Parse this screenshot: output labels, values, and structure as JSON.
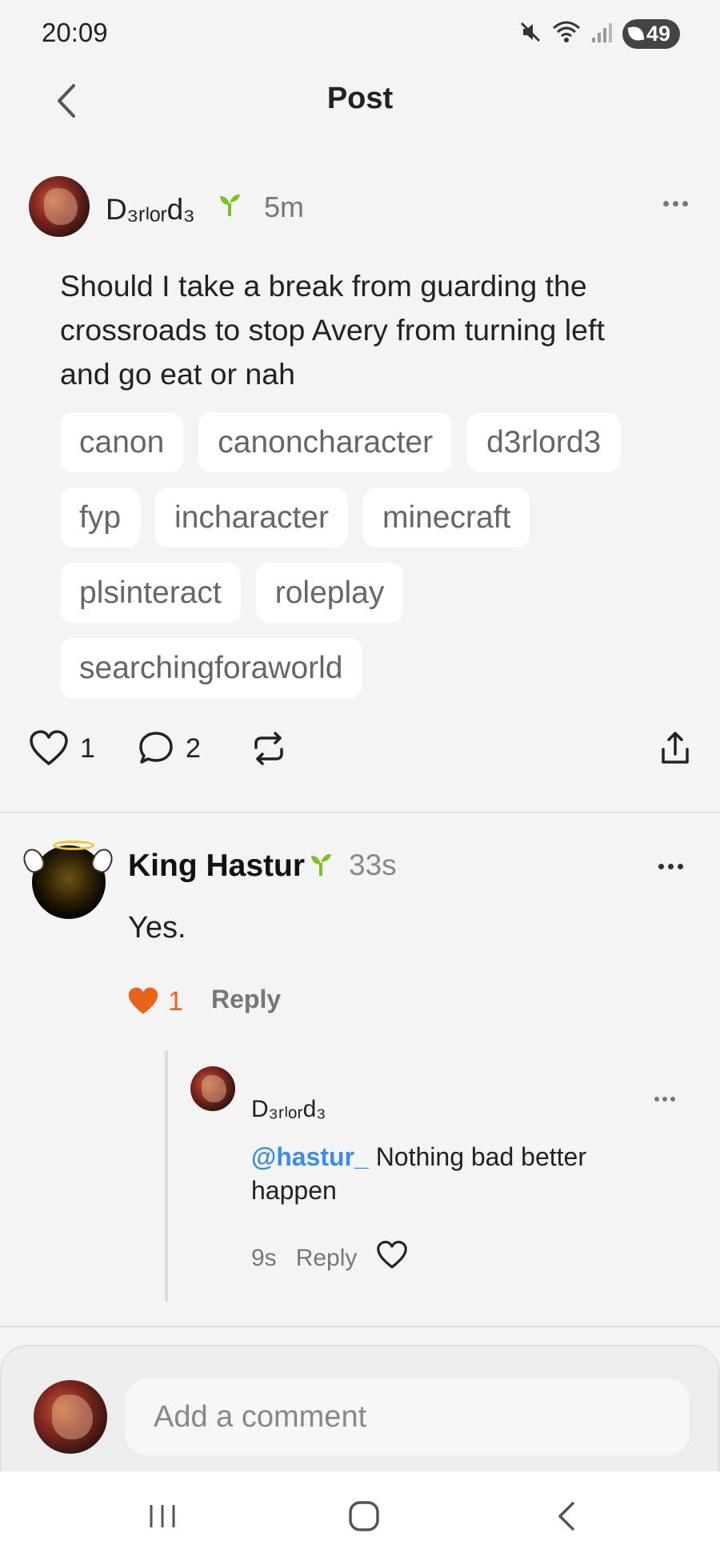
{
  "status_bar": {
    "time": "20:09",
    "battery": "49",
    "icons": [
      "mute-icon",
      "wifi-icon",
      "signal-icon",
      "battery-icon"
    ]
  },
  "header": {
    "title": "Post",
    "back_icon": "chevron-left-icon"
  },
  "post": {
    "author": "D₃ᵣₗₒᵣd₃",
    "time": "5m",
    "text": "Should I take a break from guarding the crossroads to stop Avery from turning left and go eat or nah",
    "tags": [
      "canon",
      "canoncharacter",
      "d3rlord3",
      "fyp",
      "incharacter",
      "minecraft",
      "plsinteract",
      "roleplay",
      "searchingforaworld"
    ],
    "likes": "1",
    "comments": "2"
  },
  "comment": {
    "author": "King Hastur",
    "time": "33s",
    "text": "Yes.",
    "likes": "1",
    "reply_label": "Reply"
  },
  "reply": {
    "author": "D₃ᵣₗₒᵣd₃",
    "mention": "@hastur_",
    "text": " Nothing bad better happen",
    "time": "9s",
    "reply_label": "Reply"
  },
  "composer": {
    "placeholder": "Add a comment"
  },
  "colors": {
    "accent_orange": "#e8641a",
    "mention_blue": "#3a8fe0",
    "sprout_green": "#7cc11f"
  }
}
